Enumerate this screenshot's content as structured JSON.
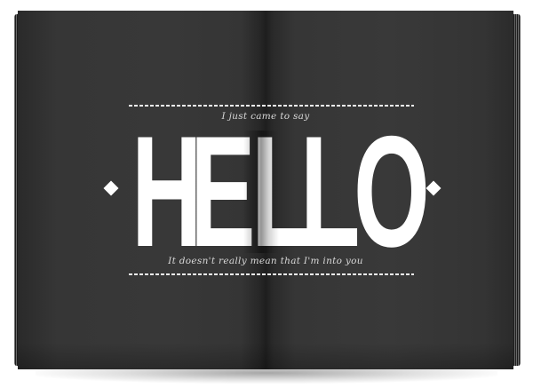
{
  "tagline_top": "I just came to say",
  "headline": {
    "letters": [
      "H",
      "E",
      "L",
      "L",
      "O"
    ]
  },
  "tagline_bottom": "It doesn't really mean that I'm into you",
  "colors": {
    "page": "#363636",
    "text": "#ffffff",
    "background": "#ffffff"
  }
}
